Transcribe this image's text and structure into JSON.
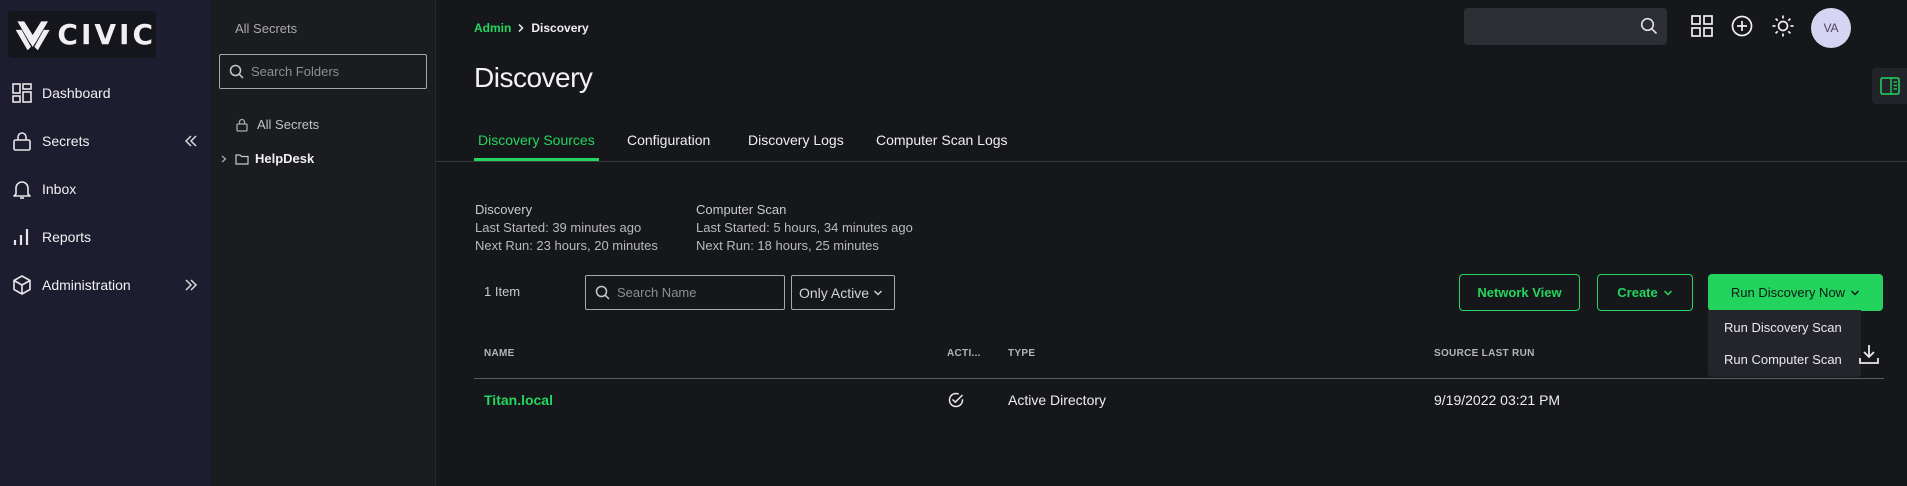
{
  "brand": {
    "name": "CIVIC"
  },
  "nav": {
    "items": [
      {
        "label": "Dashboard",
        "icon": "dashboard-icon"
      },
      {
        "label": "Secrets",
        "icon": "lock-icon"
      },
      {
        "label": "Inbox",
        "icon": "bell-icon"
      },
      {
        "label": "Reports",
        "icon": "bar-chart-icon"
      },
      {
        "label": "Administration",
        "icon": "cube-icon"
      }
    ]
  },
  "folders": {
    "title": "All Secrets",
    "search_placeholder": "Search Folders",
    "items": [
      {
        "label": "All Secrets",
        "icon": "lock-icon"
      },
      {
        "label": "HelpDesk",
        "icon": "folder-icon"
      }
    ]
  },
  "breadcrumb": {
    "parent": "Admin",
    "current": "Discovery"
  },
  "page": {
    "title": "Discovery"
  },
  "topbar": {
    "search_placeholder": "",
    "avatar_initials": "VA"
  },
  "tabs": [
    {
      "label": "Discovery Sources",
      "active": true
    },
    {
      "label": "Configuration",
      "active": false
    },
    {
      "label": "Discovery Logs",
      "active": false
    },
    {
      "label": "Computer Scan Logs",
      "active": false
    }
  ],
  "discovery_info": {
    "title": "Discovery",
    "last_started": "Last Started: 39 minutes ago",
    "next_run": "Next Run: 23 hours, 20 minutes"
  },
  "computer_scan_info": {
    "title": "Computer Scan",
    "last_started": "Last Started: 5 hours, 34 minutes ago",
    "next_run": "Next Run: 18 hours, 25 minutes"
  },
  "toolbar": {
    "item_count": "1 Item",
    "search_placeholder": "Search Name",
    "filter_value": "Only Active",
    "network_view_label": "Network View",
    "create_label": "Create",
    "run_now_label": "Run Discovery Now",
    "run_menu": [
      "Run Discovery Scan",
      "Run Computer Scan"
    ]
  },
  "table": {
    "columns": [
      "NAME",
      "ACTI...",
      "TYPE",
      "SOURCE LAST RUN"
    ],
    "rows": [
      {
        "name": "Titan.local",
        "active": true,
        "type": "Active Directory",
        "source_last_run": "9/19/2022 03:21 PM"
      }
    ]
  },
  "colors": {
    "accent": "#24d65f",
    "sidebar_bg": "#1d1d2f",
    "panel_bg": "#1b1c20",
    "main_bg": "#16171b"
  }
}
